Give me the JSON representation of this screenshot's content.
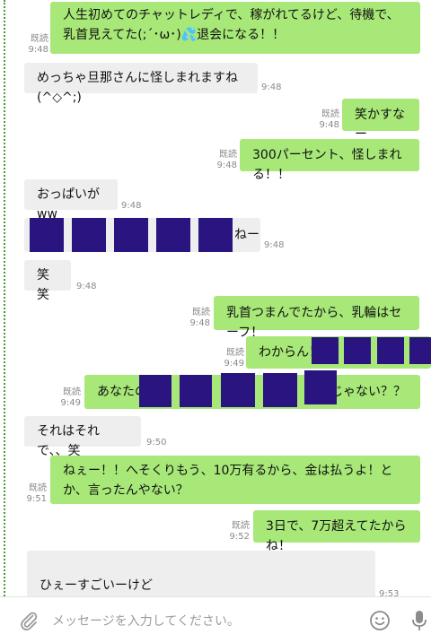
{
  "messages": [
    {
      "side": "out",
      "text": "人生初めてのチャットレディで、稼がれてるけど、待機で、乳首見えてた(;´･ω･)💦退会になる！！",
      "read": "既読",
      "time": "9:48"
    },
    {
      "side": "in",
      "text": "めっちゃ旦那さんに怪しまれますね(^◇^;)",
      "time": "9:48"
    },
    {
      "side": "out",
      "text": "笑かすなー",
      "read": "既読",
      "time": "9:48"
    },
    {
      "side": "out",
      "text": "300パーセント、怪しまれる！！",
      "read": "既読",
      "time": "9:48"
    },
    {
      "side": "in",
      "text": "おっぱいがww",
      "time": "9:48"
    },
    {
      "side": "in",
      "text": "ねー",
      "time": "9:48"
    },
    {
      "side": "in",
      "text": "笑笑",
      "time": "9:48"
    },
    {
      "side": "out",
      "text": "乳首つまんでたから、乳輪はセーフ！",
      "read": "既読",
      "time": "9:48"
    },
    {
      "side": "out",
      "text": "わからん！",
      "read": "既読",
      "time": "9:49"
    },
    {
      "side": "out",
      "text": "あなたの",
      "text2": "じゃない？？",
      "read": "既読",
      "time": "9:49"
    },
    {
      "side": "in",
      "text": "それはそれで、、笑",
      "time": "9:50"
    },
    {
      "side": "out",
      "text": "ねぇー！！へそくりもう、10万有るから、金は払うよ！とか、言ったんやない？",
      "read": "既読",
      "time": "9:51"
    },
    {
      "side": "out",
      "text": "3日で、7万超えてたからね！",
      "read": "既読",
      "time": "9:52"
    },
    {
      "side": "in",
      "text": "ひぇーすごいーけど\nなんだろう、、、せっかく稼げてるのに自分で台無しにしとる、、orz",
      "time": "9:53"
    }
  ],
  "input": {
    "placeholder": "メッセージを入力してください。"
  },
  "colors": {
    "outgoing": "#a7e878",
    "incoming": "#eeeeee",
    "redaction": "#2a1480"
  },
  "icons": [
    "paperclip-icon",
    "smiley-icon",
    "microphone-icon",
    "sweat-drop-icon"
  ]
}
